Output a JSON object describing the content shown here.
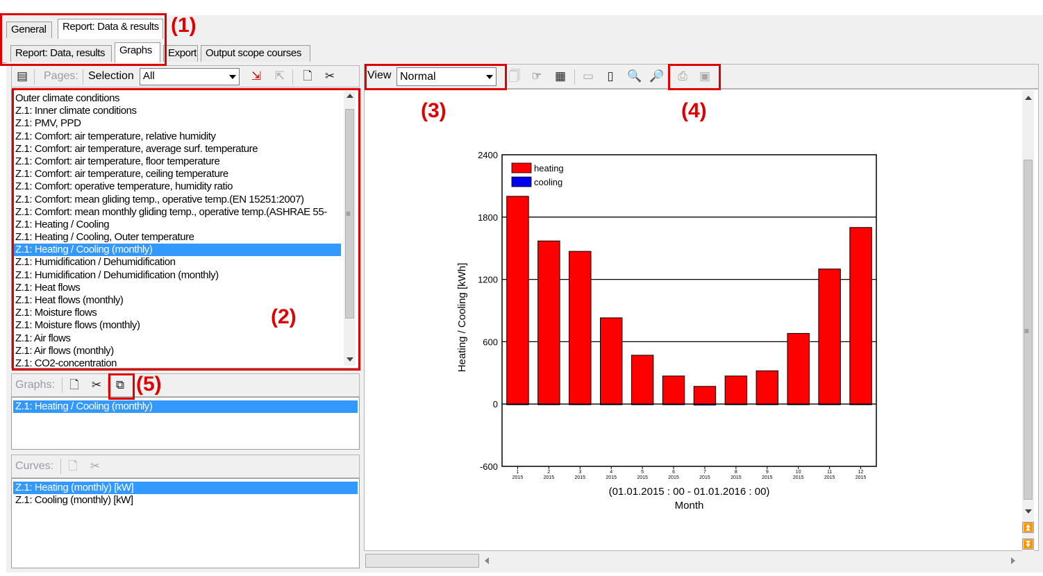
{
  "tabs_top": [
    {
      "label": "General",
      "active": false
    },
    {
      "label": "Report: Data & results",
      "active": true
    }
  ],
  "tabs_sub": [
    {
      "label": "Report: Data, results",
      "active": false
    },
    {
      "label": "Graphs",
      "active": true
    },
    {
      "label": "Export",
      "active": false
    },
    {
      "label": "Output scope courses",
      "active": false
    }
  ],
  "left_toolbar": {
    "pages_label": "Pages:",
    "selection_label": "Selection",
    "selection_value": "All"
  },
  "pages_list": [
    "Outer climate conditions",
    "Z.1: Inner climate conditions",
    "Z.1: PMV, PPD",
    "Z.1: Comfort: air temperature, relative humidity",
    "Z.1: Comfort: air temperature, average surf. temperature",
    "Z.1: Comfort: air temperature, floor temperature",
    "Z.1: Comfort: air temperature, ceiling temperature",
    "Z.1: Comfort: operative temperature, humidity ratio",
    "Z.1: Comfort: mean gliding temp., operative temp.(EN 15251:2007)",
    "Z.1: Comfort: mean monthly gliding temp., operative temp.(ASHRAE 55-",
    "Z.1: Heating / Cooling",
    "Z.1: Heating / Cooling, Outer temperature",
    "Z.1: Heating / Cooling (monthly)",
    "Z.1: Humidification / Dehumidification",
    "Z.1: Humidification / Dehumidification (monthly)",
    "Z.1: Heat flows",
    "Z.1: Heat flows (monthly)",
    "Z.1: Moisture flows",
    "Z.1: Moisture flows (monthly)",
    "Z.1: Air flows",
    "Z.1: Air flows (monthly)",
    "Z.1: CO2-concentration"
  ],
  "pages_selected_index": 12,
  "graphs": {
    "label": "Graphs:",
    "items": [
      "Z.1: Heating / Cooling (monthly)"
    ]
  },
  "curves": {
    "label": "Curves:",
    "items": [
      "Z.1: Heating (monthly) [kW]",
      "Z.1: Cooling (monthly) [kW]"
    ]
  },
  "view": {
    "label": "View",
    "value": "Normal"
  },
  "annotations": [
    "(1)",
    "(2)",
    "(3)",
    "(4)",
    "(5)"
  ],
  "colors": {
    "accent_red": "#e00000",
    "selection_blue": "#3399ff",
    "bar_heating": "#ff0000",
    "bar_cooling": "#0000ee"
  },
  "chart_data": {
    "type": "bar",
    "categories": [
      "1",
      "2",
      "3",
      "4",
      "5",
      "6",
      "7",
      "8",
      "9",
      "10",
      "11",
      "12"
    ],
    "category_sublabel": "2015",
    "series": [
      {
        "name": "heating",
        "values": [
          2000,
          1570,
          1470,
          830,
          470,
          270,
          170,
          270,
          320,
          680,
          1300,
          1700
        ]
      },
      {
        "name": "cooling",
        "values": [
          0,
          0,
          0,
          0,
          0,
          0,
          -10,
          0,
          0,
          0,
          0,
          0
        ]
      }
    ],
    "xlabel": "(01.01.2015 : 00 - 01.01.2016 : 00)",
    "xlabel2": "Month",
    "ylabel": "Heating / Cooling [kWh]",
    "ylim": [
      -600,
      2400
    ],
    "yticks": [
      -600,
      0,
      600,
      1200,
      1800,
      2400
    ],
    "gridlines": [
      0,
      600,
      1200,
      1800
    ],
    "legend_position": "top-left"
  }
}
